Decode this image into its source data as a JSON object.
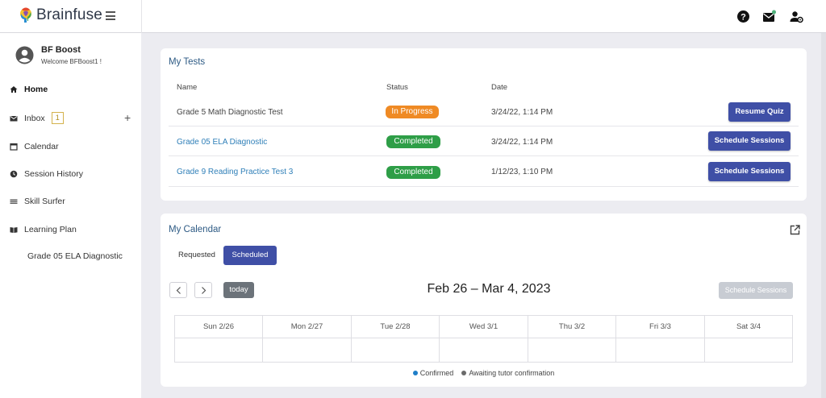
{
  "header": {
    "brand": "Brainfuse",
    "icons": [
      "help-icon",
      "mail-icon",
      "user-settings-icon"
    ]
  },
  "sidebar": {
    "user_name": "BF Boost",
    "welcome": "Welcome BFBoost1 !",
    "items": [
      {
        "label": "Home",
        "icon": "home-icon"
      },
      {
        "label": "Inbox",
        "icon": "mail-icon",
        "badge": "1"
      },
      {
        "label": "Calendar",
        "icon": "calendar-icon"
      },
      {
        "label": "Session History",
        "icon": "history-icon"
      },
      {
        "label": "Skill Surfer",
        "icon": "list-icon"
      },
      {
        "label": "Learning Plan",
        "icon": "book-icon"
      }
    ],
    "add_symbol": "+",
    "sub_item": "Grade 05 ELA Diagnostic"
  },
  "tests": {
    "title": "My Tests",
    "columns": [
      "Name",
      "Status",
      "Date"
    ],
    "rows": [
      {
        "name": "Grade 5 Math Diagnostic Test",
        "status": "In Progress",
        "date": "3/24/22, 1:14 PM",
        "action": "Resume Quiz"
      },
      {
        "name": "Grade 05 ELA Diagnostic",
        "status": "Completed",
        "date": "3/24/22, 1:14 PM",
        "action": "Schedule Sessions"
      },
      {
        "name": "Grade 9 Reading Practice Test 3",
        "status": "Completed",
        "date": "1/12/23, 1:10 PM",
        "action": "Schedule Sessions"
      }
    ]
  },
  "calendar": {
    "title": "My Calendar",
    "tabs": [
      "Requested",
      "Scheduled"
    ],
    "active_tab": "Scheduled",
    "today_label": "today",
    "range": "Feb 26 – Mar 4, 2023",
    "schedule_button": "Schedule Sessions",
    "days": [
      "Sun 2/26",
      "Mon 2/27",
      "Tue 2/28",
      "Wed 3/1",
      "Thu 3/2",
      "Fri 3/3",
      "Sat 3/4"
    ],
    "legend": [
      {
        "label": "Confirmed",
        "color": "#1f7fc8"
      },
      {
        "label": "Awaiting tutor confirmation",
        "color": "#6b6b6b"
      }
    ]
  },
  "colors": {
    "primary": "#3f4fa6",
    "in_progress": "#ef8a24",
    "completed": "#2e9e47",
    "link": "#2f7fb8",
    "title": "#2d5a84"
  }
}
